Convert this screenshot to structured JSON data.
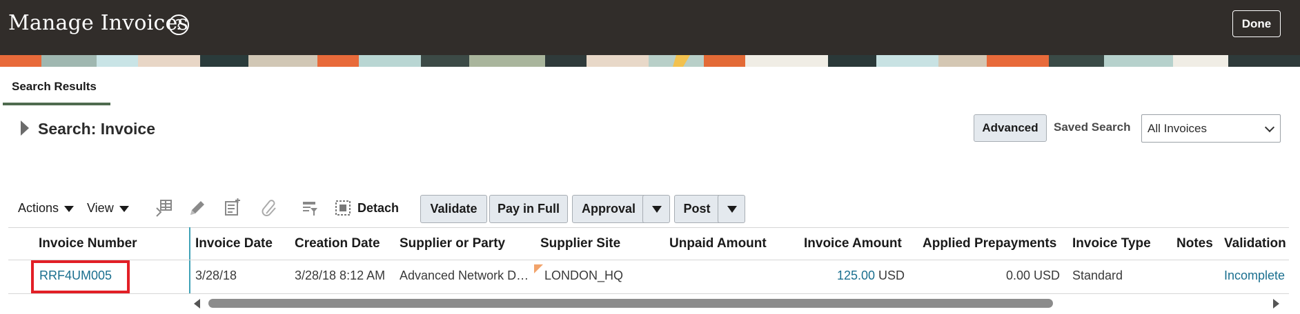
{
  "header": {
    "title": "Manage Invoices",
    "help_glyph": "?",
    "done_label": "Done"
  },
  "tabs": [
    {
      "label": "Search Results",
      "selected": true
    }
  ],
  "search": {
    "title": "Search: Invoice",
    "advanced_label": "Advanced",
    "saved_search_label": "Saved Search",
    "saved_search_value": "All Invoices"
  },
  "toolbar": {
    "actions_label": "Actions",
    "view_label": "View",
    "icons": [
      "freeze-columns-icon",
      "edit-pencil-icon",
      "edit-list-icon",
      "attachment-icon",
      "query-by-example-icon",
      "detach-icon"
    ],
    "detach_label": "Detach",
    "validate_label": "Validate",
    "pay_in_full_label": "Pay in Full",
    "approval_label": "Approval",
    "post_label": "Post"
  },
  "table": {
    "columns": [
      "Invoice Number",
      "Invoice Date",
      "Creation Date",
      "Supplier or Party",
      "Supplier Site",
      "Unpaid Amount",
      "Invoice Amount",
      "Applied Prepayments",
      "Invoice Type",
      "Notes",
      "Validation"
    ],
    "rows": [
      {
        "invoice_number": "RRF4UM005",
        "invoice_date": "3/28/18",
        "creation_date": "3/28/18 8:12 AM",
        "supplier": "Advanced Network D…",
        "supplier_site": "LONDON_HQ",
        "unpaid_amount": "",
        "invoice_amount": "125.00",
        "invoice_currency": "USD",
        "applied_prepayments": "0.00 USD",
        "invoice_type": "Standard",
        "notes": "",
        "validation": "Incomplete"
      }
    ]
  },
  "colors": {
    "header_bg": "#312d2a",
    "link": "#1a6f8f",
    "highlight": "#e21f26",
    "button_bg": "#e4e9ee",
    "tab_underline": "#4f6b4f"
  }
}
